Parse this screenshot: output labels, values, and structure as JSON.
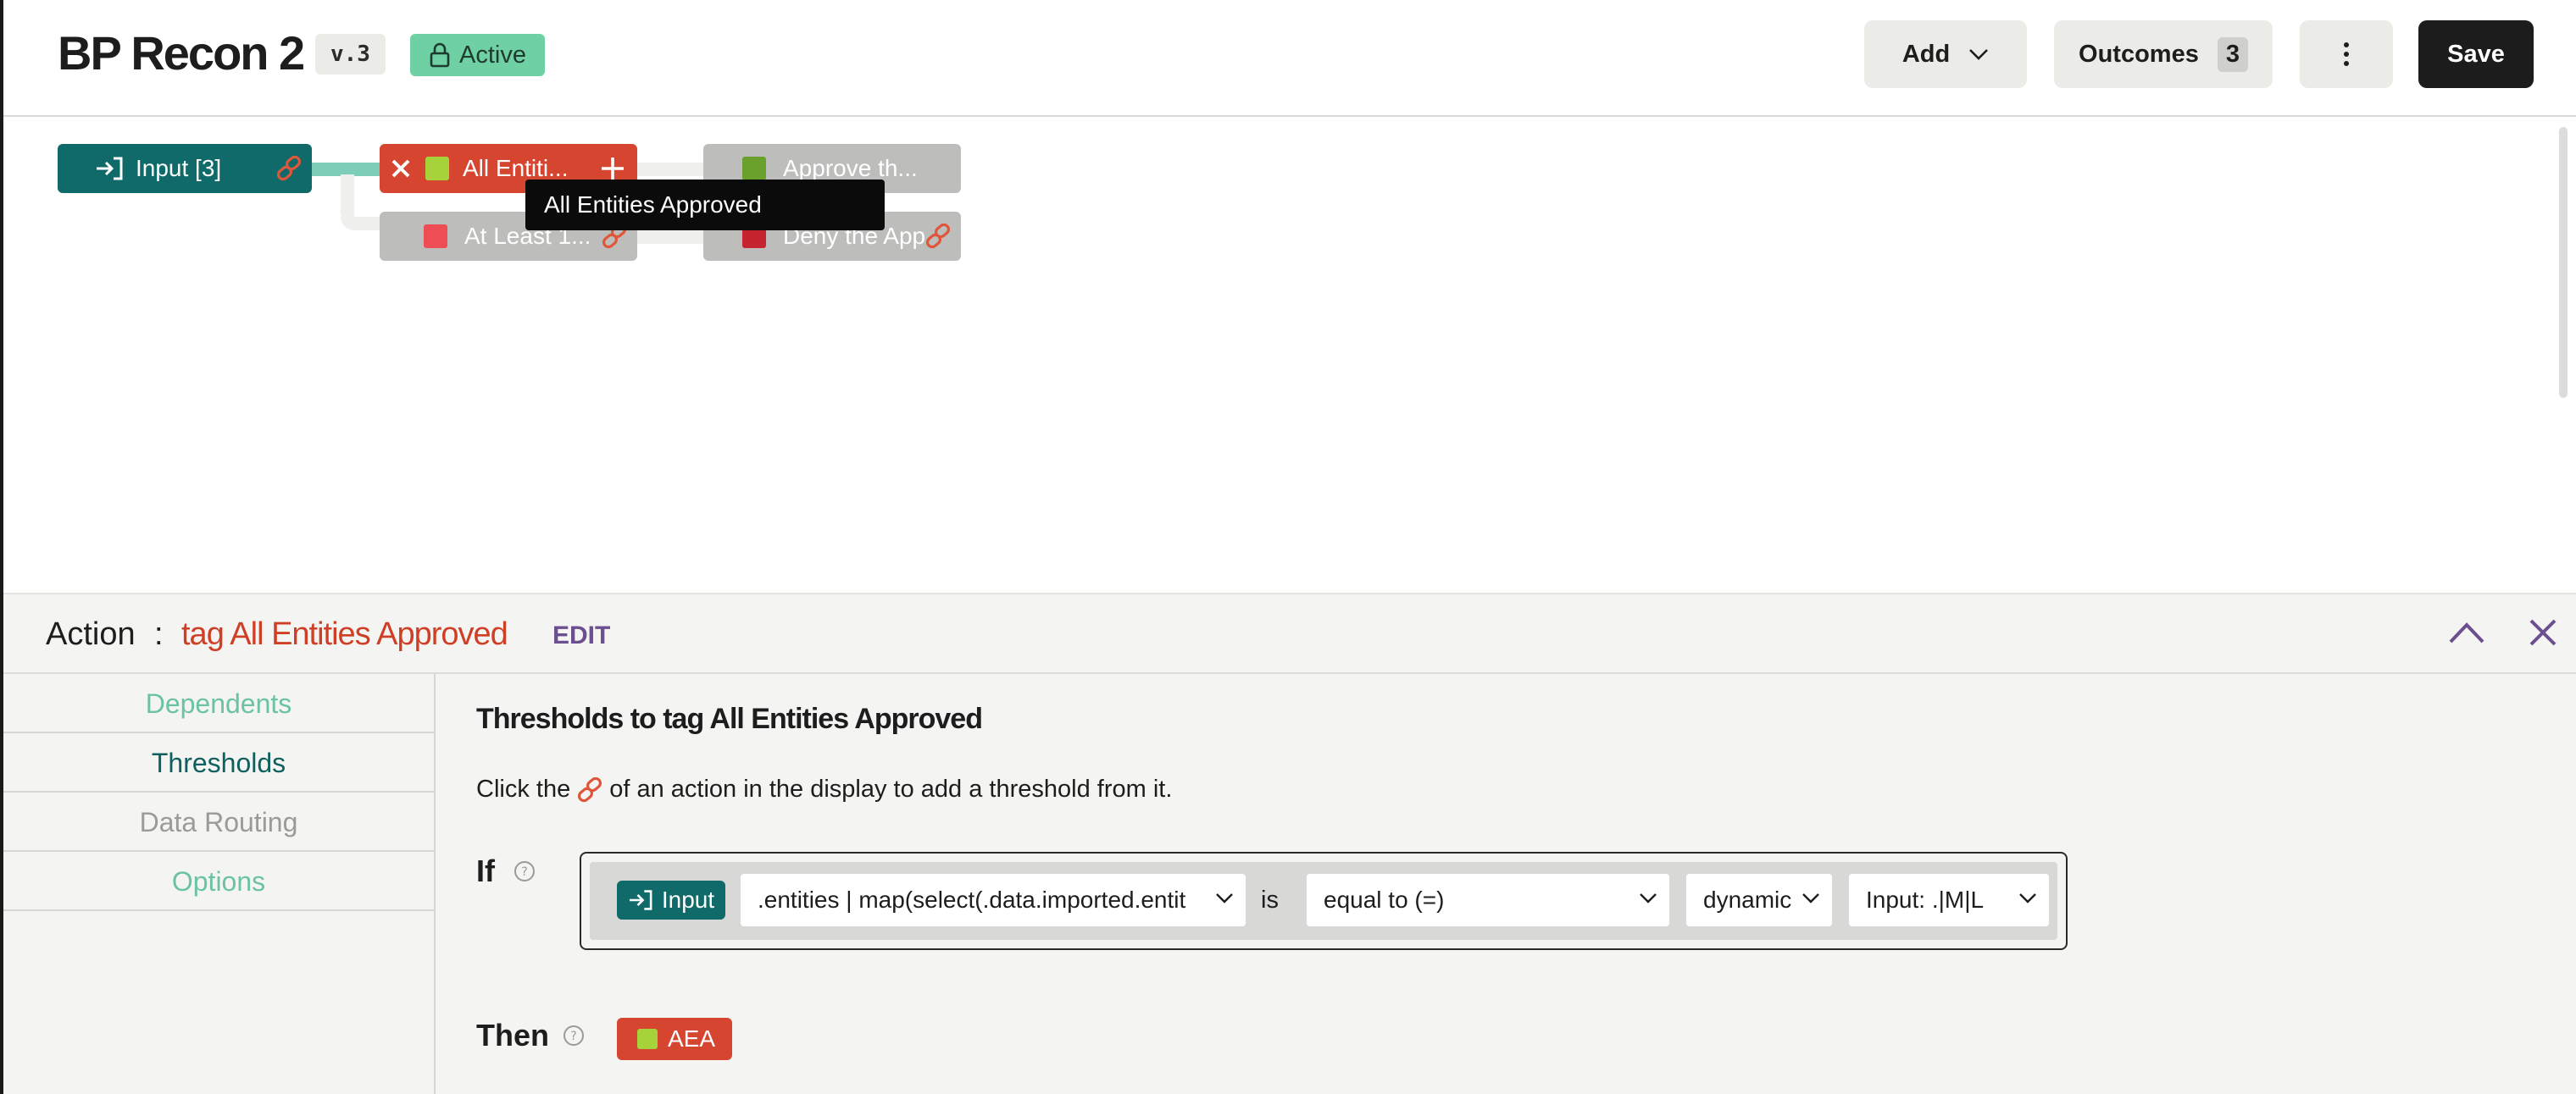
{
  "header": {
    "title": "BP Recon 2",
    "version": "v.3",
    "status": "Active",
    "add_label": "Add",
    "outcomes_label": "Outcomes",
    "outcomes_count": "3",
    "save_label": "Save"
  },
  "graph": {
    "nodes": {
      "input": "Input [3]",
      "all_entities": "All Entiti...",
      "at_least": "At Least 1...",
      "approve": "Approve th...",
      "deny": "Deny the App"
    },
    "tooltip": "All Entities Approved"
  },
  "panel": {
    "action_label": "Action",
    "colon": ":",
    "action_name": "tag All Entities Approved",
    "edit_label": "EDIT",
    "tabs": [
      "Dependents",
      "Thresholds",
      "Data Routing",
      "Options"
    ],
    "section_title": "Thresholds to tag All Entities Approved",
    "hint_before": "Click the",
    "hint_after": "of an action in the display to add a threshold from it.",
    "if_label": "If",
    "condition": {
      "source": "Input",
      "path": ".entities | map(select(.data.imported.entit",
      "is_text": "is",
      "operator": "equal to (=)",
      "mode": "dynamic",
      "value": "Input: .|M|L"
    },
    "then_label": "Then",
    "then_chip": "AEA"
  },
  "colors": {
    "teal": "#0f6a69",
    "red": "#d64530",
    "green_square": "#a6d33a",
    "approve_square": "#6aa12c",
    "at_least_square": "#ef4d55",
    "deny_square": "#c6252f",
    "active_badge": "#6fd0a4",
    "edit_purple": "#6b4f8f"
  }
}
